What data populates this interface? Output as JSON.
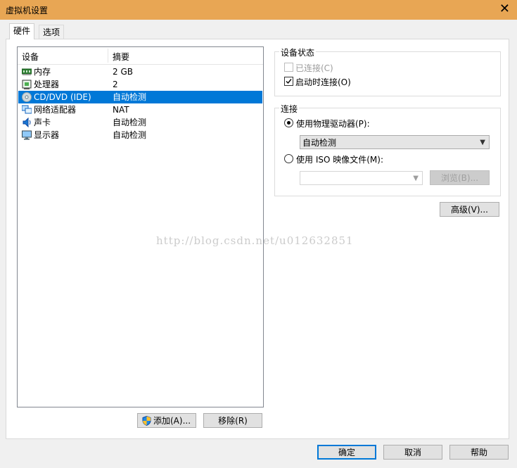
{
  "window": {
    "title": "虚拟机设置",
    "close_glyph": "✕"
  },
  "tabs": [
    {
      "label": "硬件",
      "active": true
    },
    {
      "label": "选项",
      "active": false
    }
  ],
  "device_list": {
    "columns": [
      "设备",
      "摘要"
    ],
    "rows": [
      {
        "device": "内存",
        "summary": "2 GB",
        "icon": "memory-icon"
      },
      {
        "device": "处理器",
        "summary": "2",
        "icon": "processor-icon"
      },
      {
        "device": "CD/DVD (IDE)",
        "summary": "自动检测",
        "icon": "cd-dvd-icon",
        "selected": true
      },
      {
        "device": "网络适配器",
        "summary": "NAT",
        "icon": "network-adapter-icon"
      },
      {
        "device": "声卡",
        "summary": "自动检测",
        "icon": "sound-card-icon"
      },
      {
        "device": "显示器",
        "summary": "自动检测",
        "icon": "display-icon"
      }
    ]
  },
  "list_buttons": {
    "add": "添加(A)...",
    "remove": "移除(R)"
  },
  "device_status": {
    "label": "设备状态",
    "connected": {
      "label": "已连接(C)",
      "checked": false,
      "disabled": true
    },
    "connect_at_power_on": {
      "label": "启动时连接(O)",
      "checked": true
    }
  },
  "connection": {
    "label": "连接",
    "use_physical": {
      "label": "使用物理驱动器(P):",
      "selected": true
    },
    "physical_drive_value": "自动检测",
    "use_iso": {
      "label": "使用 ISO 映像文件(M):",
      "selected": false
    },
    "iso_path_value": "",
    "browse_label": "浏览(B)..."
  },
  "advanced_label": "高级(V)...",
  "footer": {
    "ok": "确定",
    "cancel": "取消",
    "help": "帮助"
  },
  "watermark": "http://blog.csdn.net/u012632851",
  "colors": {
    "titlebar": "#e8a654",
    "selection": "#0078d7",
    "dialog_bg": "#f0f0f0"
  }
}
